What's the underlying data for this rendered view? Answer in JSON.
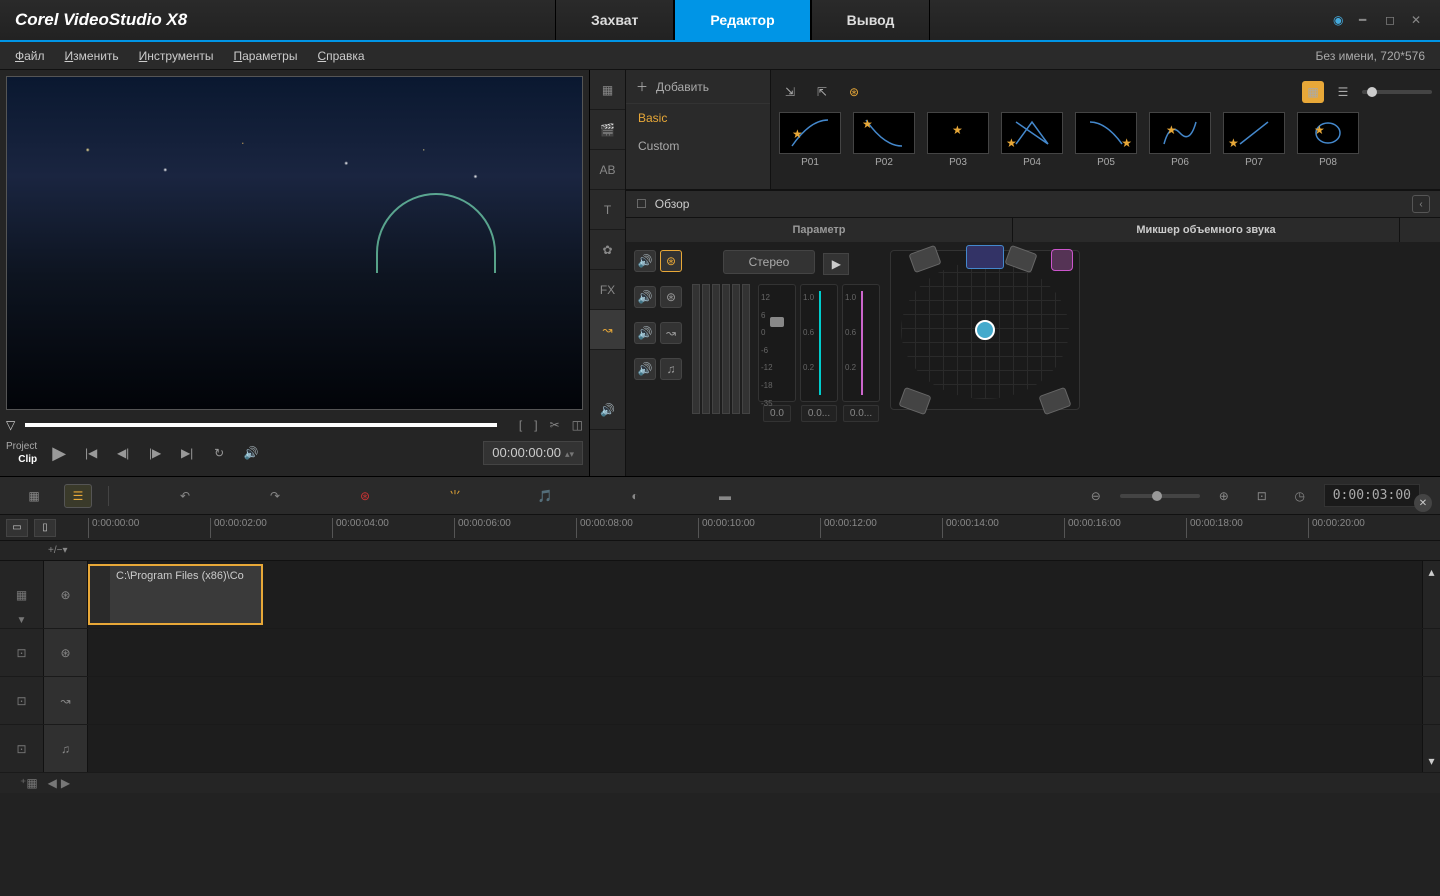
{
  "app": {
    "title": "Corel VideoStudio X8"
  },
  "main_tabs": {
    "capture": "Захват",
    "editor": "Редактор",
    "output": "Вывод"
  },
  "menu": {
    "file": "Файл",
    "edit": "Изменить",
    "tools": "Инструменты",
    "params": "Параметры",
    "help": "Справка"
  },
  "status": "Без имени, 720*576",
  "preview": {
    "project": "Project",
    "clip": "Clip",
    "timecode": "00:00:00:00"
  },
  "library": {
    "add": "Добавить",
    "basic": "Basic",
    "custom": "Custom",
    "review": "Обзор",
    "presets": [
      "P01",
      "P02",
      "P03",
      "P04",
      "P05",
      "P06",
      "P07",
      "P08"
    ]
  },
  "mixer": {
    "tab_param": "Параметр",
    "tab_surround": "Микшер объемного звука",
    "stereo": "Стерео",
    "scale_main": [
      "12",
      "6",
      "0",
      "-6",
      "-12",
      "-18",
      "-35"
    ],
    "scale_sub": [
      "1.0",
      "0.6",
      "0.2"
    ],
    "val_main": "0.0",
    "val_sub1": "0.0...",
    "val_sub2": "0.0..."
  },
  "timeline": {
    "timecode": "0:00:03:00",
    "ticks": [
      "0:00:00:00",
      "00:00:02:00",
      "00:00:04:00",
      "00:00:06:00",
      "00:00:08:00",
      "00:00:10:00",
      "00:00:12:00",
      "00:00:14:00",
      "00:00:16:00",
      "00:00:18:00",
      "00:00:20:00"
    ],
    "expand": "+/−▾",
    "clip_path": "C:\\Program Files (x86)\\Co"
  }
}
